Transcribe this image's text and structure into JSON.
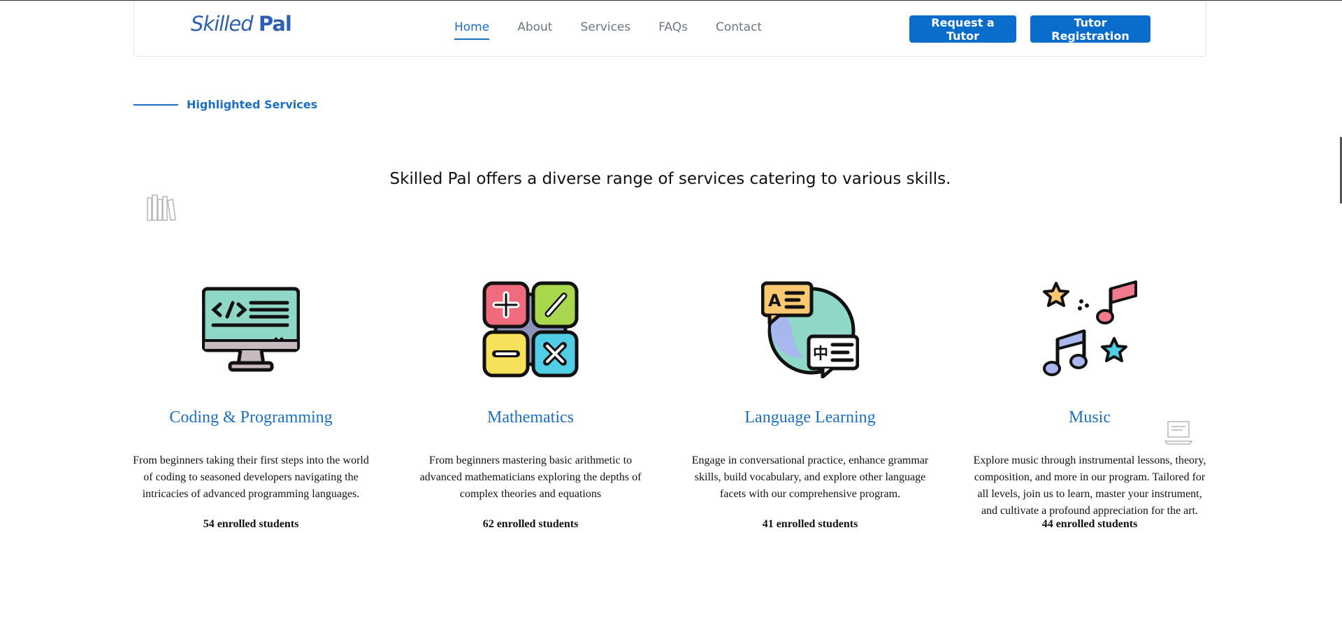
{
  "header": {
    "logo_part1": "Skilled",
    "logo_part2": "Pal",
    "nav": [
      {
        "label": "Home",
        "active": true
      },
      {
        "label": "About",
        "active": false
      },
      {
        "label": "Services",
        "active": false
      },
      {
        "label": "FAQs",
        "active": false
      },
      {
        "label": "Contact",
        "active": false
      }
    ],
    "request_button": "Request a Tutor",
    "register_button": "Tutor Registration"
  },
  "section": {
    "eyebrow": "Highlighted Services",
    "headline": "Skilled Pal offers a diverse range of services catering to various skills."
  },
  "services": [
    {
      "title": "Coding & Programming",
      "icon": "code-monitor-icon",
      "description": "From beginners taking their first steps into the world of coding to seasoned developers navigating the intricacies of advanced programming languages.",
      "count": "54 enrolled students"
    },
    {
      "title": "Mathematics",
      "icon": "math-operators-icon",
      "description": "From beginners mastering basic arithmetic to advanced mathematicians exploring the depths of complex theories and equations",
      "count": "62 enrolled students"
    },
    {
      "title": "Language Learning",
      "icon": "language-globe-icon",
      "description": "Engage in conversational practice, enhance grammar skills, build vocabulary, and explore other language facets with our comprehensive program.",
      "count": "41 enrolled students"
    },
    {
      "title": "Music",
      "icon": "music-notes-icon",
      "description": "Explore music through instrumental lessons, theory, composition, and more in our program. Tailored for all levels, join us to learn, master your instrument, and cultivate a profound appreciation for the art.",
      "count": "44 enrolled students"
    }
  ],
  "colors": {
    "brand": "#0b6dcb",
    "accent_text": "#1d6fc2",
    "nav_text": "#6b7784"
  }
}
